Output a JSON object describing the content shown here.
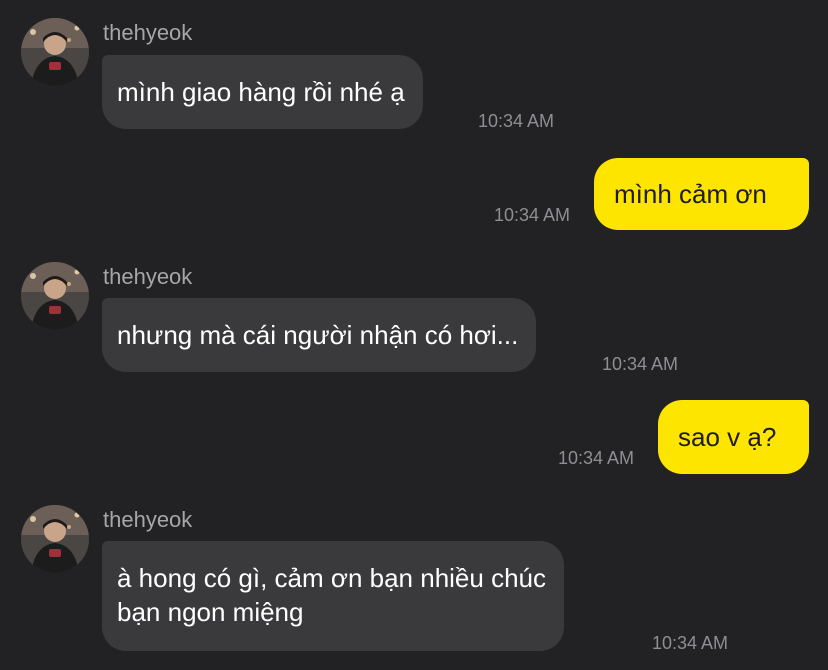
{
  "messages": [
    {
      "direction": "in",
      "sender": "thehyeok",
      "text": "mình giao hàng rồi nhé ạ",
      "time": "10:34 AM"
    },
    {
      "direction": "out",
      "text": "mình cảm ơn",
      "time": "10:34 AM"
    },
    {
      "direction": "in",
      "sender": "thehyeok",
      "text": "nhưng mà cái người nhận có hơi...",
      "time": "10:34 AM"
    },
    {
      "direction": "out",
      "text": "sao v ạ?",
      "time": "10:34 AM"
    },
    {
      "direction": "in",
      "sender": "thehyeok",
      "text_line1": "à hong có gì, cảm ơn bạn nhiều chúc",
      "text_line2": "bạn ngon miệng",
      "time": "10:34 AM"
    }
  ],
  "colors": {
    "background": "#222224",
    "incoming_bubble": "#3a3a3c",
    "outgoing_bubble": "#fee500",
    "timestamp": "#8e8e93",
    "sender_name": "#a6a6a8"
  },
  "icons": {
    "avatar": "profile-photo-avatar-icon"
  }
}
